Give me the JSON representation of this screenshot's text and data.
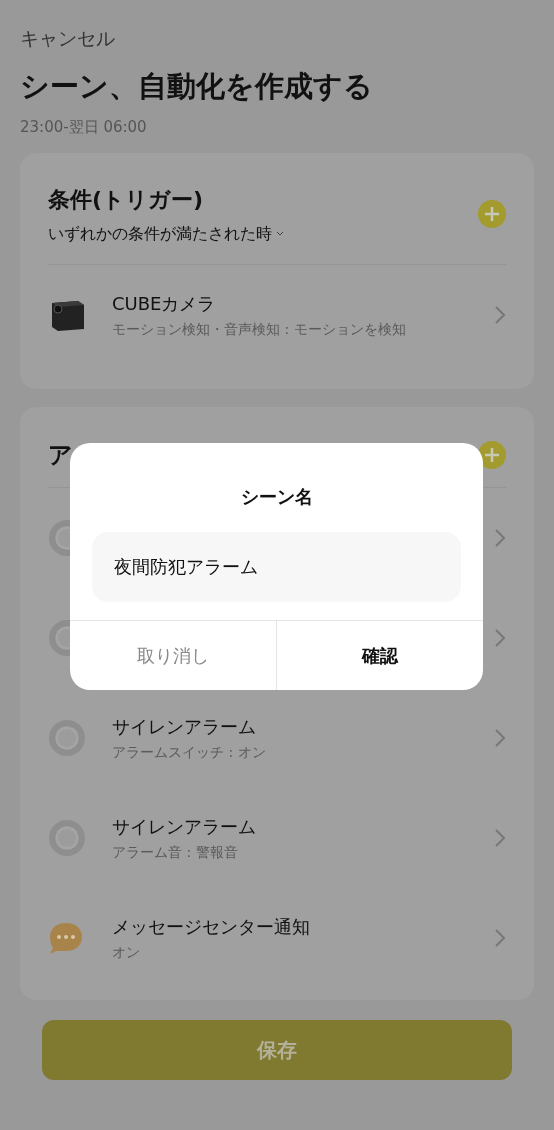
{
  "header": {
    "cancel": "キャンセル",
    "title": "シーン、自動化を作成する",
    "time": "23:00-翌日 06:00"
  },
  "conditions": {
    "title": "条件(トリガー)",
    "mode": "いずれかの条件が満たされた時",
    "rows": [
      {
        "kind": "camera",
        "title": "CUBEカメラ",
        "subtitle": "モーション検知・音声検知 : モーションを検知"
      }
    ]
  },
  "actions": {
    "title": "ア",
    "rows": [
      {
        "kind": "siren"
      },
      {
        "kind": "siren"
      },
      {
        "kind": "siren",
        "title": "サイレンアラーム",
        "subtitle": "アラームスイッチ : オン"
      },
      {
        "kind": "siren",
        "title": "サイレンアラーム",
        "subtitle": "アラーム音 : 警報音"
      },
      {
        "kind": "message",
        "title": "メッセージセンター通知",
        "subtitle": "オン"
      }
    ]
  },
  "save_button": "保存",
  "dialog": {
    "title": "シーン名",
    "value": "夜間防犯アラーム",
    "cancel": "取り消し",
    "confirm": "確認"
  }
}
